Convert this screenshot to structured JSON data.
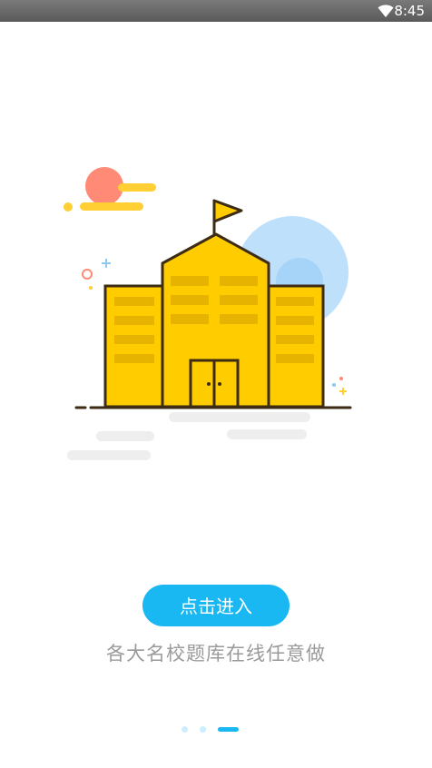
{
  "status_bar": {
    "time": "8:45",
    "icons": [
      "wifi-icon"
    ]
  },
  "onboarding": {
    "enter_button_label": "点击进入",
    "tagline": "各大名校题库在线任意做",
    "illustration": "school-building-illustration",
    "page_indicator": {
      "total": 3,
      "active": 3
    }
  },
  "colors": {
    "accent": "#19b8f2",
    "building": "#ffcc00",
    "outline": "#3d2b14",
    "sun": "#ff8a75",
    "sky_circle": "#bfe0fb",
    "tagline": "#9a9a9a"
  }
}
